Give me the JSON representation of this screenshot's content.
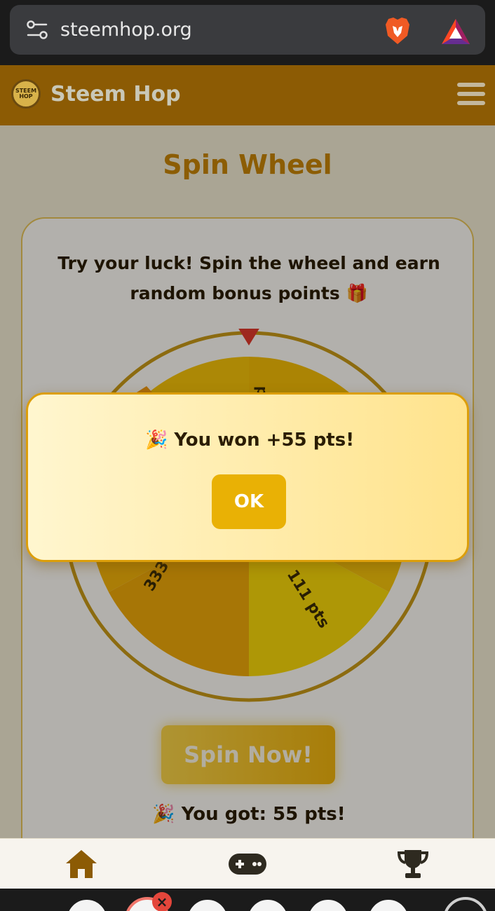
{
  "browser": {
    "url": "steemhop.org",
    "settings_icon": "tune-icon",
    "brave_icon": "brave-lion-icon",
    "bat_icon": "bat-triangle-icon"
  },
  "header": {
    "logo_text": "STEEM HOP",
    "brand": "Steem Hop",
    "menu_icon": "hamburger-menu-icon"
  },
  "main": {
    "title": "Spin Wheel",
    "description": "Try your luck! Spin the wheel and earn random bonus points 🎁",
    "wheel": {
      "segments": [
        {
          "label": "pts",
          "color": "#f2b705"
        },
        {
          "label": "111 pts",
          "color": "#f8d706"
        },
        {
          "label": "333 pts",
          "color": "#f0a90a"
        }
      ],
      "pointer_icon": "red-triangle-pointer-icon"
    },
    "spin_button": "Spin Now!",
    "result_text": "🎉 You got: 55 pts!"
  },
  "modal": {
    "message": "🎉 You won +55 pts!",
    "ok_label": "OK"
  },
  "bottom_nav": {
    "items": [
      {
        "icon": "home-icon",
        "active": true
      },
      {
        "icon": "gamepad-icon",
        "active": false
      },
      {
        "icon": "trophy-icon",
        "active": false
      }
    ]
  },
  "colors": {
    "header_bg": "#8c5b04",
    "accent": "#e9b105",
    "title": "#c98606"
  }
}
